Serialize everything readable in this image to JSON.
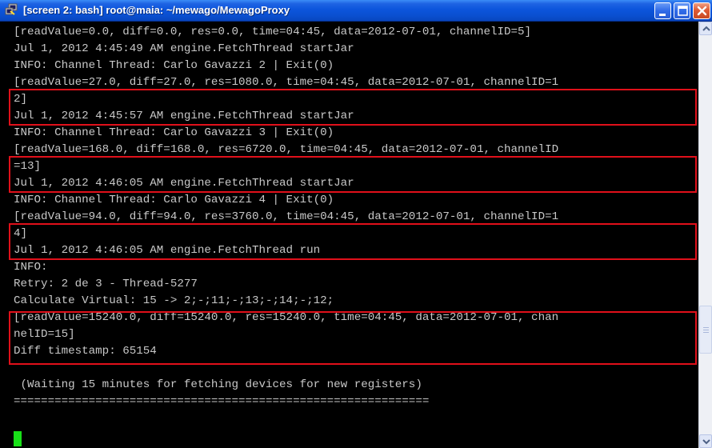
{
  "window": {
    "title": "[screen 2: bash] root@maia: ~/mewago/MewagoProxy",
    "icon": "putty-icon"
  },
  "colors": {
    "terminal_bg": "#000000",
    "terminal_fg": "#c8c8c8",
    "highlight_border": "#e0101a",
    "cursor": "#18e018",
    "titlebar": "#0c55dc"
  },
  "terminal": {
    "lines": [
      "[readValue=0.0, diff=0.0, res=0.0, time=04:45, data=2012-07-01, channelID=5]",
      "Jul 1, 2012 4:45:49 AM engine.FetchThread startJar",
      "INFO: Channel Thread: Carlo Gavazzi 2 | Exit(0)",
      "[readValue=27.0, diff=27.0, res=1080.0, time=04:45, data=2012-07-01, channelID=1",
      "2]",
      "Jul 1, 2012 4:45:57 AM engine.FetchThread startJar",
      "INFO: Channel Thread: Carlo Gavazzi 3 | Exit(0)",
      "[readValue=168.0, diff=168.0, res=6720.0, time=04:45, data=2012-07-01, channelID",
      "=13]",
      "Jul 1, 2012 4:46:05 AM engine.FetchThread startJar",
      "INFO: Channel Thread: Carlo Gavazzi 4 | Exit(0)",
      "[readValue=94.0, diff=94.0, res=3760.0, time=04:45, data=2012-07-01, channelID=1",
      "4]",
      "Jul 1, 2012 4:46:05 AM engine.FetchThread run",
      "INFO:",
      "Retry: 2 de 3 - Thread-5277",
      "Calculate Virtual: 15 -> 2;-;11;-;13;-;14;-;12;",
      "[readValue=15240.0, diff=15240.0, res=15240.0, time=04:45, data=2012-07-01, chan",
      "nelID=15]",
      "Diff timestamp: 65154",
      "",
      " (Waiting 15 minutes for fetching devices for new registers)",
      "============================================================="
    ]
  },
  "scrollbar": {
    "up_icon": "arrow-up-icon",
    "down_icon": "arrow-down-icon"
  }
}
